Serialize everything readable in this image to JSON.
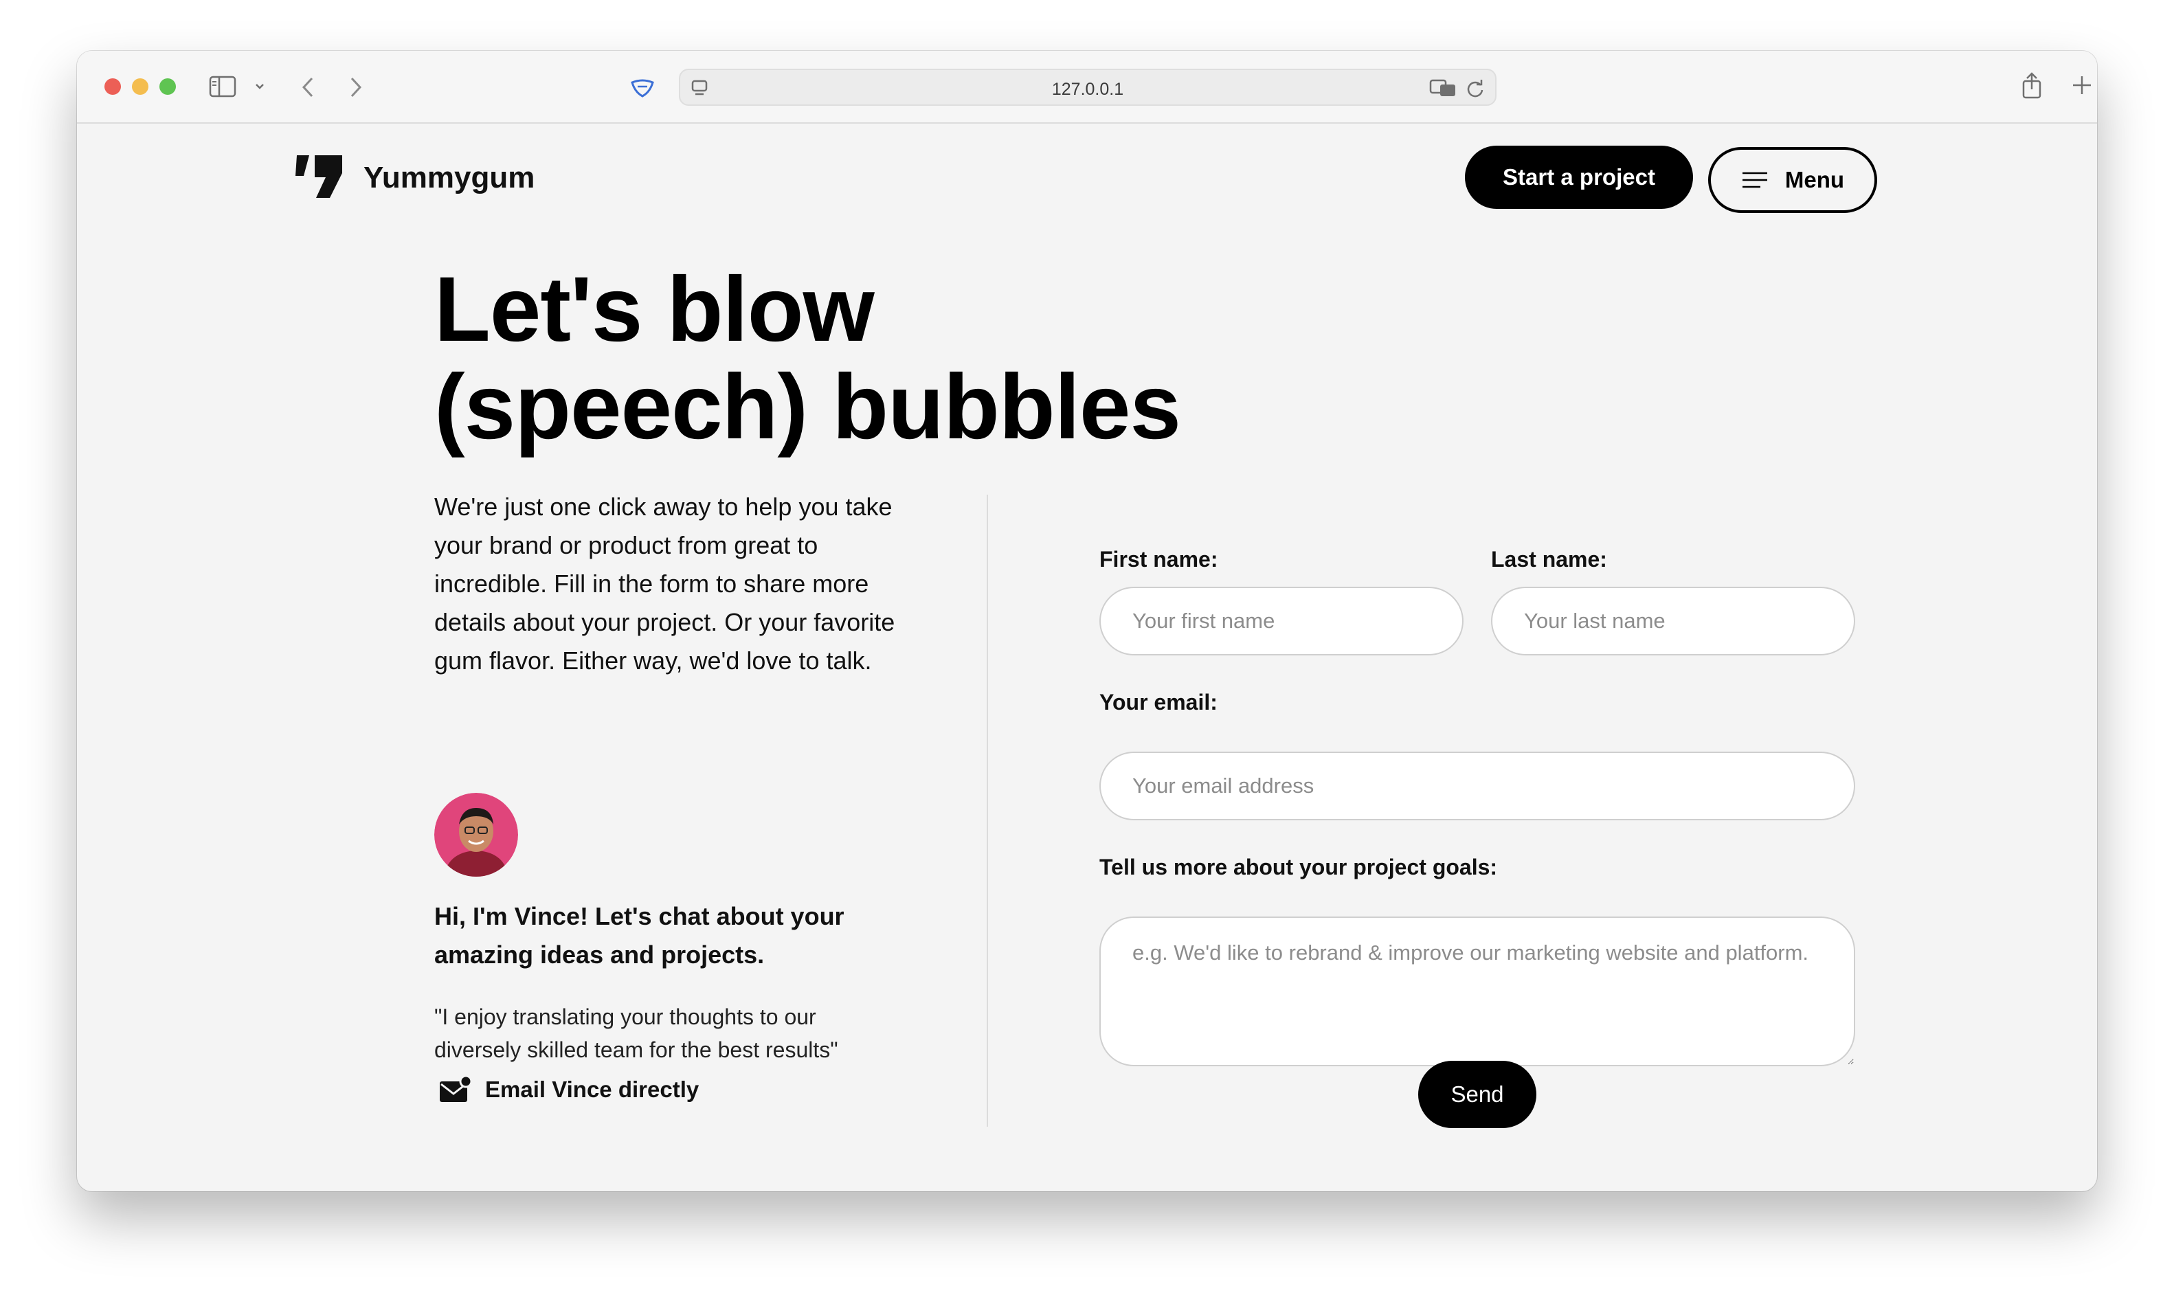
{
  "browser": {
    "url": "127.0.0.1"
  },
  "header": {
    "brand": "Yummygum",
    "start_project_label": "Start a project",
    "menu_label": "Menu"
  },
  "hero": {
    "headline_line1": "Let's blow",
    "headline_line2": "(speech) bubbles",
    "intro": "We're just one click away to help you take your brand or product from great to incredible. Fill in the form to share more details about your project. Or your favorite gum flavor. Either way, we'd love to talk."
  },
  "contact_person": {
    "title": "Hi, I'm Vince! Let's chat about your amazing ideas and projects.",
    "quote": "\"I enjoy translating your thoughts to our diversely skilled team for the best results\"",
    "email_label": "Email Vince directly"
  },
  "form": {
    "first_name_label": "First name:",
    "first_name_placeholder": "Your first name",
    "last_name_label": "Last name:",
    "last_name_placeholder": "Your last name",
    "email_label": "Your email:",
    "email_placeholder": "Your email address",
    "goals_label": "Tell us more about your project goals:",
    "goals_placeholder": "e.g. We'd like to rebrand & improve our marketing website and platform.",
    "send_label": "Send"
  },
  "colors": {
    "page_background": "#f4f4f4",
    "primary_button": "#000000",
    "avatar_background": "#e0457b"
  }
}
